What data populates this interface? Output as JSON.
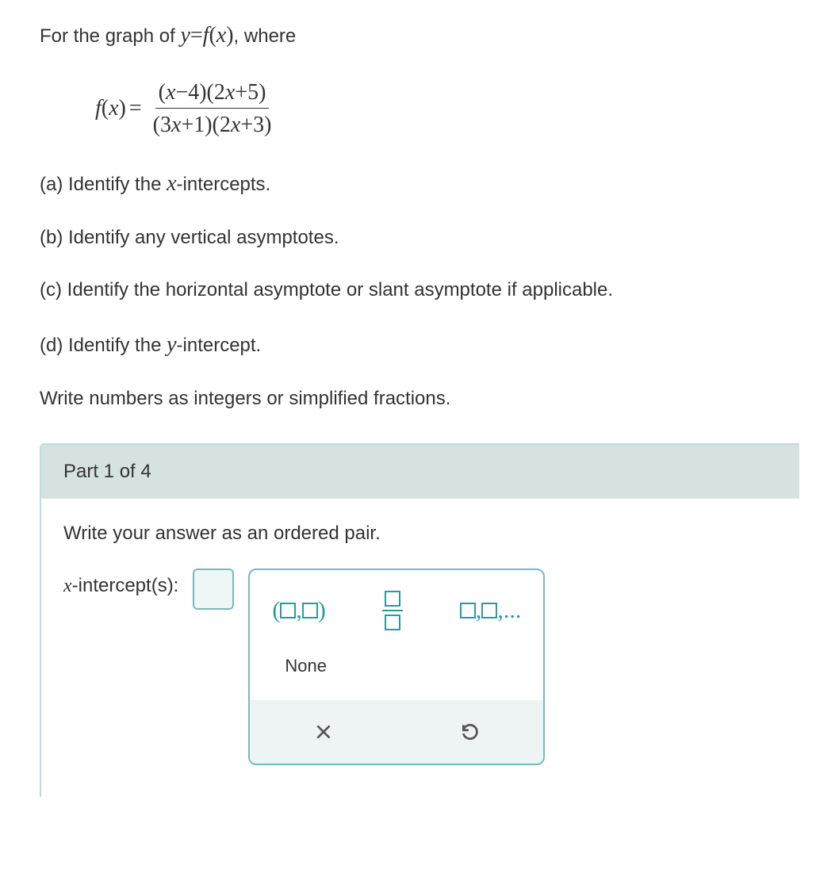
{
  "intro": {
    "prefix": "For the graph of ",
    "eq_lhs_y": "y",
    "eq_eq": "=",
    "eq_f": "f",
    "eq_paren_open": "(",
    "eq_x": "x",
    "eq_paren_close": ")",
    "suffix": ", where"
  },
  "function": {
    "lhs_f": "f",
    "lhs_open": "(",
    "lhs_x": "x",
    "lhs_close": ")",
    "eq": "=",
    "num": "(x−4)(2x+5)",
    "den": "(3x+1)(2x+3)"
  },
  "parts": {
    "a": "(a) Identify the ",
    "a_var": "x",
    "a_suffix": "-intercepts.",
    "b": "(b) Identify any vertical asymptotes.",
    "c": "(c) Identify the horizontal asymptote or slant asymptote if applicable.",
    "d": "(d) Identify the ",
    "d_var": "y",
    "d_suffix": "-intercept."
  },
  "instructions": "Write numbers as integers or simplified fractions.",
  "answer": {
    "part_label": "Part 1 of 4",
    "prompt": "Write your answer as an ordered pair.",
    "label_var": "x",
    "label_suffix": "-intercept(s):",
    "palette": {
      "ordered_pair_open": "(",
      "ordered_pair_comma": ",",
      "ordered_pair_close": ")",
      "list_comma": ",",
      "list_ellipsis": ",...",
      "none": "None"
    }
  }
}
